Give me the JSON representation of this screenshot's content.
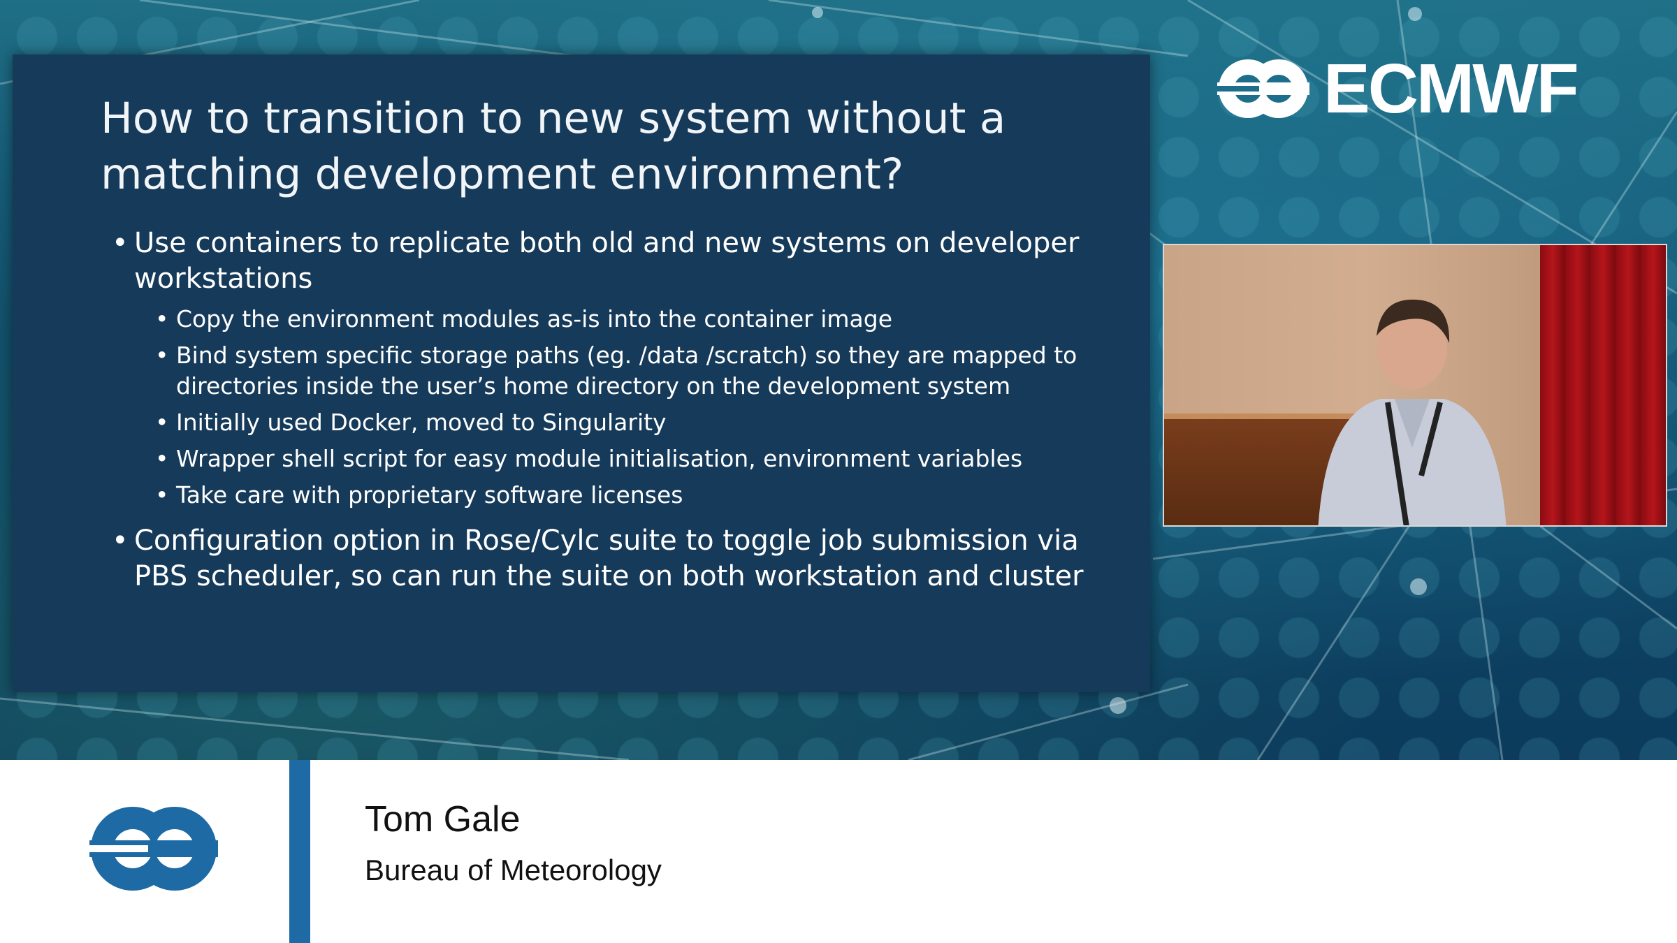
{
  "slide": {
    "title_line1": "How to transition to new system without a",
    "title_line2": "matching development environment?",
    "bullets": {
      "b1": "Use containers to replicate both old and new systems on developer workstations",
      "b1_sub": [
        "Copy the environment modules as-is into the container image",
        "Bind system specific storage paths (eg. /data /scratch) so they are mapped to directories inside the user’s home directory on the development system",
        "Initially used Docker, moved to Singularity",
        "Wrapper shell script for easy module initialisation, environment variables",
        "Take care with proprietary software licenses"
      ],
      "b2": "Configuration option in Rose/Cylc suite to toggle job submission via PBS scheduler, so can run the suite on both workstation and cluster"
    }
  },
  "branding": {
    "wordmark": "ECMWF",
    "logo_icon": "ecmwf-logo-icon",
    "accent_color": "#1d6aa5"
  },
  "lower_third": {
    "speaker_name": "Tom Gale",
    "organization": "Bureau of Meteorology"
  },
  "colors": {
    "slide_bg": "#163a59",
    "text": "#ffffff",
    "lower_third_bg": "#ffffff"
  }
}
